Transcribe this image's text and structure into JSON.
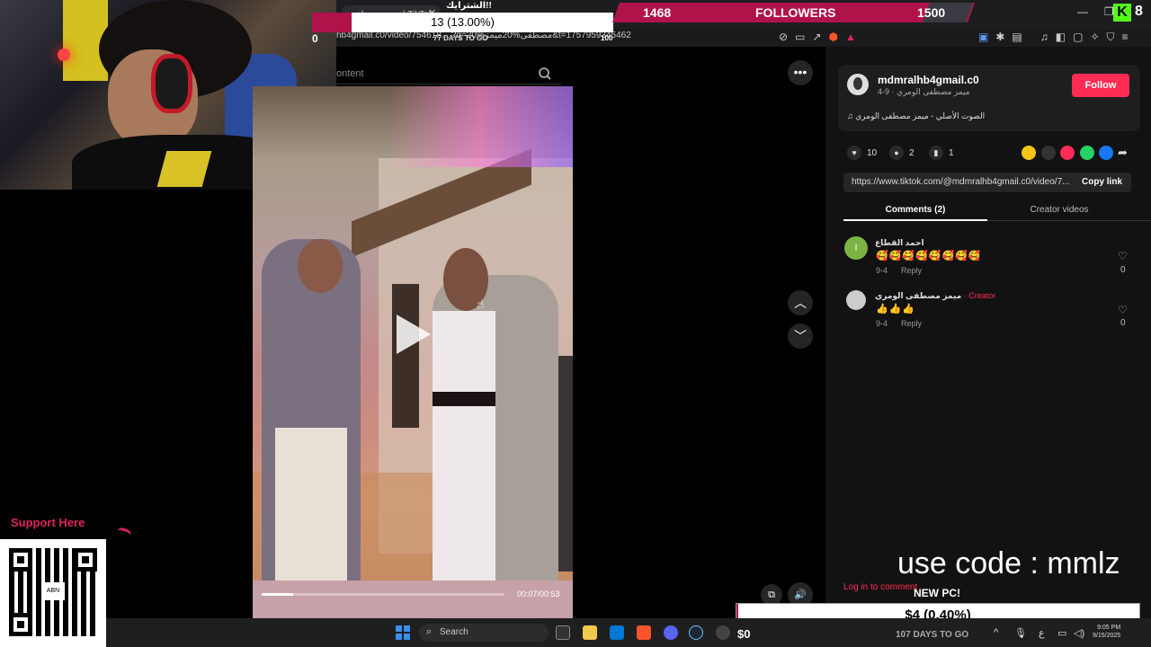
{
  "browser": {
    "tab_title": "رميز مصطفى | TikTok",
    "url": "hb4gmail.c0/video/754618... ?q=مصطفى%20ميمز%20&t=1757959345462",
    "window_min": "—",
    "window_max": "❐"
  },
  "donation_goal": {
    "label": "الشترايك!!",
    "amount_text": "13 (13.00%)",
    "fill_percent": 13,
    "zero": "0",
    "days": "77 DAYS TO GO",
    "goal": "100"
  },
  "followers": {
    "current": "1468",
    "label": "FOLLOWERS",
    "target": "1500"
  },
  "kick": {
    "logo": "K",
    "count": "8"
  },
  "search": {
    "placeholder": "ontent"
  },
  "page_cut_text": "nt",
  "video": {
    "current_time": "00:07/00:53",
    "progress_fraction": 0.13
  },
  "post": {
    "username": "mdmralhb4gmail.c0",
    "subline": "ميمز مصطفى الومري · 9-4",
    "follow_label": "Follow",
    "music": "الصوت الأصلي - ميمز مصطفى الومري",
    "likes": "10",
    "comments_count": "2",
    "saves": "1",
    "link": "https://www.tiktok.com/@mdmralhb4gmail.c0/video/7...",
    "copy_link": "Copy link"
  },
  "tabs": {
    "comments": "Comments (2)",
    "creator": "Creator videos"
  },
  "comments": [
    {
      "avatar_letter": "I",
      "name": "احمد القطاع",
      "text": "🥰🥰🥰🥰🥰🥰🥰🥰",
      "date": "9-4",
      "reply": "Reply",
      "likes": "0"
    },
    {
      "name": "ميمز مصطفى الومري",
      "creator_tag": "· Creator",
      "text": "👍👍👍",
      "date": "9-4",
      "reply": "Reply",
      "likes": "0"
    }
  ],
  "login_prompt": "Log in to comment",
  "overlay": {
    "code": "use code : mmlz",
    "support": "Support Here",
    "qr_label": "ABN",
    "pc_label": "NEW PC!",
    "pc_amount": "$4 (0.40%)",
    "pc_fill_percent": 0.4,
    "pc_days": "107 DAYS TO GO",
    "money": "$0"
  },
  "taskbar": {
    "search": "Search",
    "clock_time": "9:05 PM",
    "clock_date": "9/15/2025"
  },
  "colors": {
    "tiktok_red": "#fe2c55",
    "stream_magenta": "#b0124a",
    "kick_green": "#53fc18"
  }
}
